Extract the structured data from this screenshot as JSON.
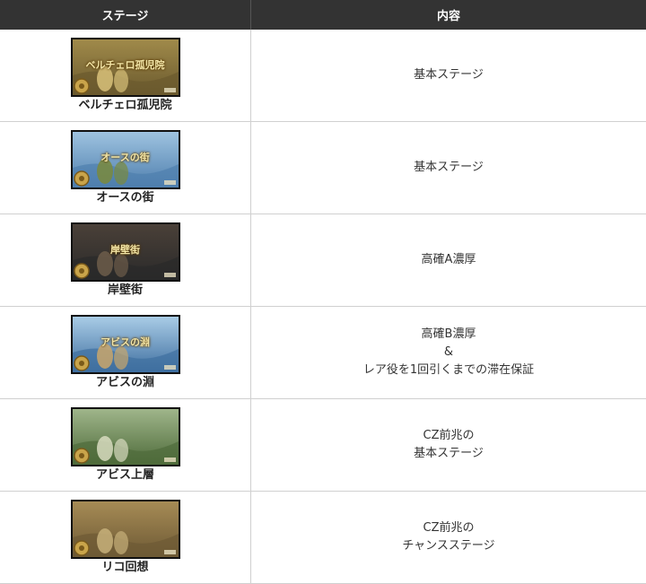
{
  "header": {
    "stage": "ステージ",
    "content": "内容"
  },
  "rows": [
    {
      "name": "ベルチェロ孤児院",
      "thumb_title": "ベルチェロ孤児院",
      "icon": "orphanage-stage-thumbnail",
      "lines": [
        "基本ステージ"
      ],
      "palette": [
        "#6b5a2e",
        "#a08a4a",
        "#d9c27a"
      ]
    },
    {
      "name": "オースの街",
      "thumb_title": "オースの街",
      "icon": "orth-town-stage-thumbnail",
      "lines": [
        "基本ステージ"
      ],
      "palette": [
        "#4f7fae",
        "#9ec3e0",
        "#7a8a3c"
      ]
    },
    {
      "name": "岸壁街",
      "thumb_title": "岸壁街",
      "icon": "cliff-town-stage-thumbnail",
      "lines": [
        "高確A濃厚"
      ],
      "palette": [
        "#2a2a2a",
        "#4a4038",
        "#6d5d4a"
      ]
    },
    {
      "name": "アビスの淵",
      "thumb_title": "アビスの淵",
      "icon": "abyss-edge-stage-thumbnail",
      "lines": [
        "高確B濃厚",
        "&",
        "レア役を1回引くまでの滞在保証"
      ],
      "palette": [
        "#3f6fa0",
        "#a9cce6",
        "#c9a66b"
      ]
    },
    {
      "name": "アビス上層",
      "thumb_title": "",
      "icon": "abyss-upper-layer-stage-thumbnail",
      "lines": [
        "CZ前兆の",
        "基本ステージ"
      ],
      "palette": [
        "#4e6b3a",
        "#9fb58a",
        "#d8dcc0"
      ]
    },
    {
      "name": "リコ回想",
      "thumb_title": "",
      "icon": "riko-memory-stage-thumbnail",
      "lines": [
        "CZ前兆の",
        "チャンスステージ"
      ],
      "palette": [
        "#6e5a35",
        "#a68b55",
        "#c7b07a"
      ]
    }
  ]
}
